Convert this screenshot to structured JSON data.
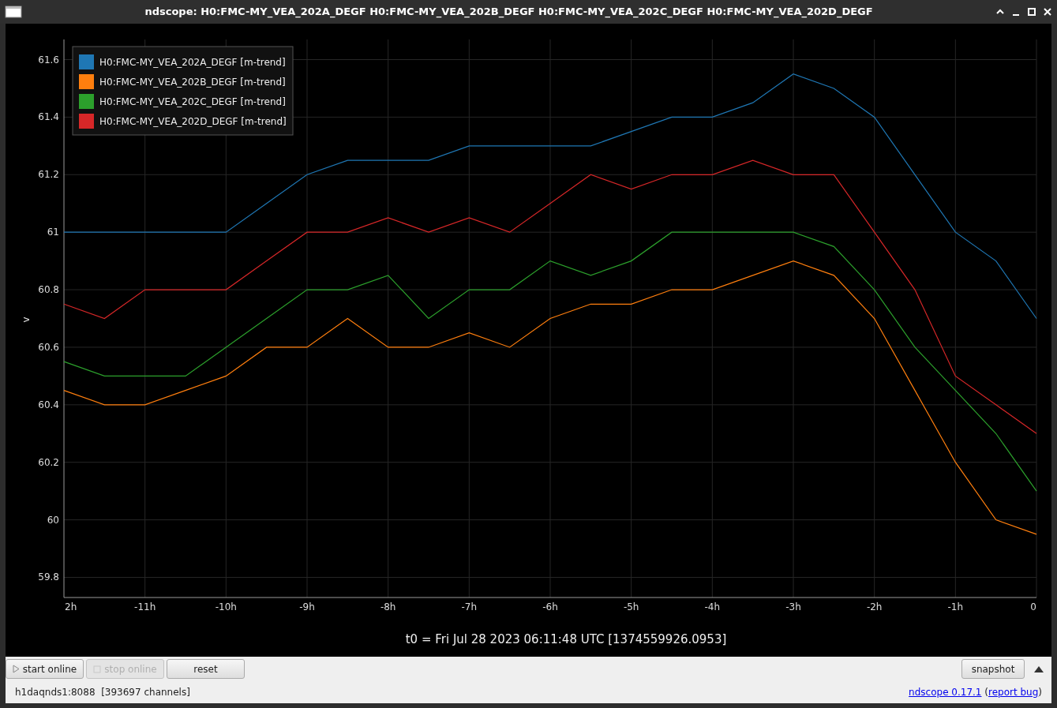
{
  "window": {
    "title": "ndscope: H0:FMC-MY_VEA_202A_DEGF H0:FMC-MY_VEA_202B_DEGF H0:FMC-MY_VEA_202C_DEGF H0:FMC-MY_VEA_202D_DEGF"
  },
  "plot": {
    "chart_data": {
      "type": "line",
      "xlabel": "t0 = Fri Jul 28 2023 06:11:48 UTC [1374559926.0953]",
      "ylabel": "v",
      "x": [
        -12,
        -11.5,
        -11,
        -10.5,
        -10,
        -9.5,
        -9,
        -8.5,
        -8,
        -7.5,
        -7,
        -6.5,
        -6,
        -5.5,
        -5,
        -4.5,
        -4,
        -3.5,
        -3,
        -2.5,
        -2,
        -1.5,
        -1,
        -0.5,
        0
      ],
      "series": [
        {
          "name": "H0:FMC-MY_VEA_202A_DEGF [m-trend]",
          "color": "#1f77b4",
          "values": [
            61.0,
            61.0,
            61.0,
            61.0,
            61.0,
            61.1,
            61.2,
            61.25,
            61.25,
            61.25,
            61.3,
            61.3,
            61.3,
            61.3,
            61.35,
            61.4,
            61.4,
            61.45,
            61.55,
            61.5,
            61.4,
            61.2,
            61.0,
            60.9,
            60.7
          ]
        },
        {
          "name": "H0:FMC-MY_VEA_202B_DEGF [m-trend]",
          "color": "#ff7f0e",
          "values": [
            60.45,
            60.4,
            60.4,
            60.45,
            60.5,
            60.6,
            60.6,
            60.7,
            60.6,
            60.6,
            60.65,
            60.6,
            60.7,
            60.75,
            60.75,
            60.8,
            60.8,
            60.85,
            60.9,
            60.85,
            60.7,
            60.45,
            60.2,
            60.0,
            59.95
          ]
        },
        {
          "name": "H0:FMC-MY_VEA_202C_DEGF [m-trend]",
          "color": "#2ca02c",
          "values": [
            60.55,
            60.5,
            60.5,
            60.5,
            60.6,
            60.7,
            60.8,
            60.8,
            60.85,
            60.7,
            60.8,
            60.8,
            60.9,
            60.85,
            60.9,
            61.0,
            61.0,
            61.0,
            61.0,
            60.95,
            60.8,
            60.6,
            60.45,
            60.3,
            60.1
          ]
        },
        {
          "name": "H0:FMC-MY_VEA_202D_DEGF [m-trend]",
          "color": "#d62728",
          "values": [
            60.75,
            60.7,
            60.8,
            60.8,
            60.8,
            60.9,
            61.0,
            61.0,
            61.05,
            61.0,
            61.05,
            61.0,
            61.1,
            61.2,
            61.15,
            61.2,
            61.2,
            61.25,
            61.2,
            61.2,
            61.0,
            60.8,
            60.5,
            60.4,
            60.3
          ]
        }
      ],
      "xlim": [
        -12,
        0
      ],
      "ylim": [
        59.73,
        61.67
      ],
      "grid": true,
      "legend": true,
      "xticks": [
        {
          "value": -11,
          "label": "-11h"
        },
        {
          "value": -10,
          "label": "-10h"
        },
        {
          "value": -9,
          "label": "-9h"
        },
        {
          "value": -8,
          "label": "-8h"
        },
        {
          "value": -7,
          "label": "-7h"
        },
        {
          "value": -6,
          "label": "-6h"
        },
        {
          "value": -5,
          "label": "-5h"
        },
        {
          "value": -4,
          "label": "-4h"
        },
        {
          "value": -3,
          "label": "-3h"
        },
        {
          "value": -2,
          "label": "-2h"
        },
        {
          "value": -1,
          "label": "-1h"
        },
        {
          "value": 0,
          "label": "0"
        }
      ],
      "yticks": [
        {
          "value": 59.8,
          "label": "59.8"
        },
        {
          "value": 60,
          "label": "60"
        },
        {
          "value": 60.2,
          "label": "60.2"
        },
        {
          "value": 60.4,
          "label": "60.4"
        },
        {
          "value": 60.6,
          "label": "60.6"
        },
        {
          "value": 60.8,
          "label": "60.8"
        },
        {
          "value": 61,
          "label": "61"
        },
        {
          "value": 61.2,
          "label": "61.2"
        },
        {
          "value": 61.4,
          "label": "61.4"
        },
        {
          "value": 61.6,
          "label": "61.6"
        }
      ]
    },
    "x_edge_label": "2h"
  },
  "toolbar": {
    "buttons": [
      {
        "label": "start online",
        "kind": "play",
        "disabled": false
      },
      {
        "label": "stop online",
        "kind": "stop",
        "disabled": true
      },
      {
        "label": "reset",
        "kind": "plain",
        "disabled": false
      }
    ],
    "snapshot": "snapshot"
  },
  "status_bar": {
    "server": "h1daqnds1:8088  [393697 channels]",
    "version_link": "ndscope 0.17.1",
    "open": "(",
    "report_link": "report bug",
    "close": ")"
  }
}
